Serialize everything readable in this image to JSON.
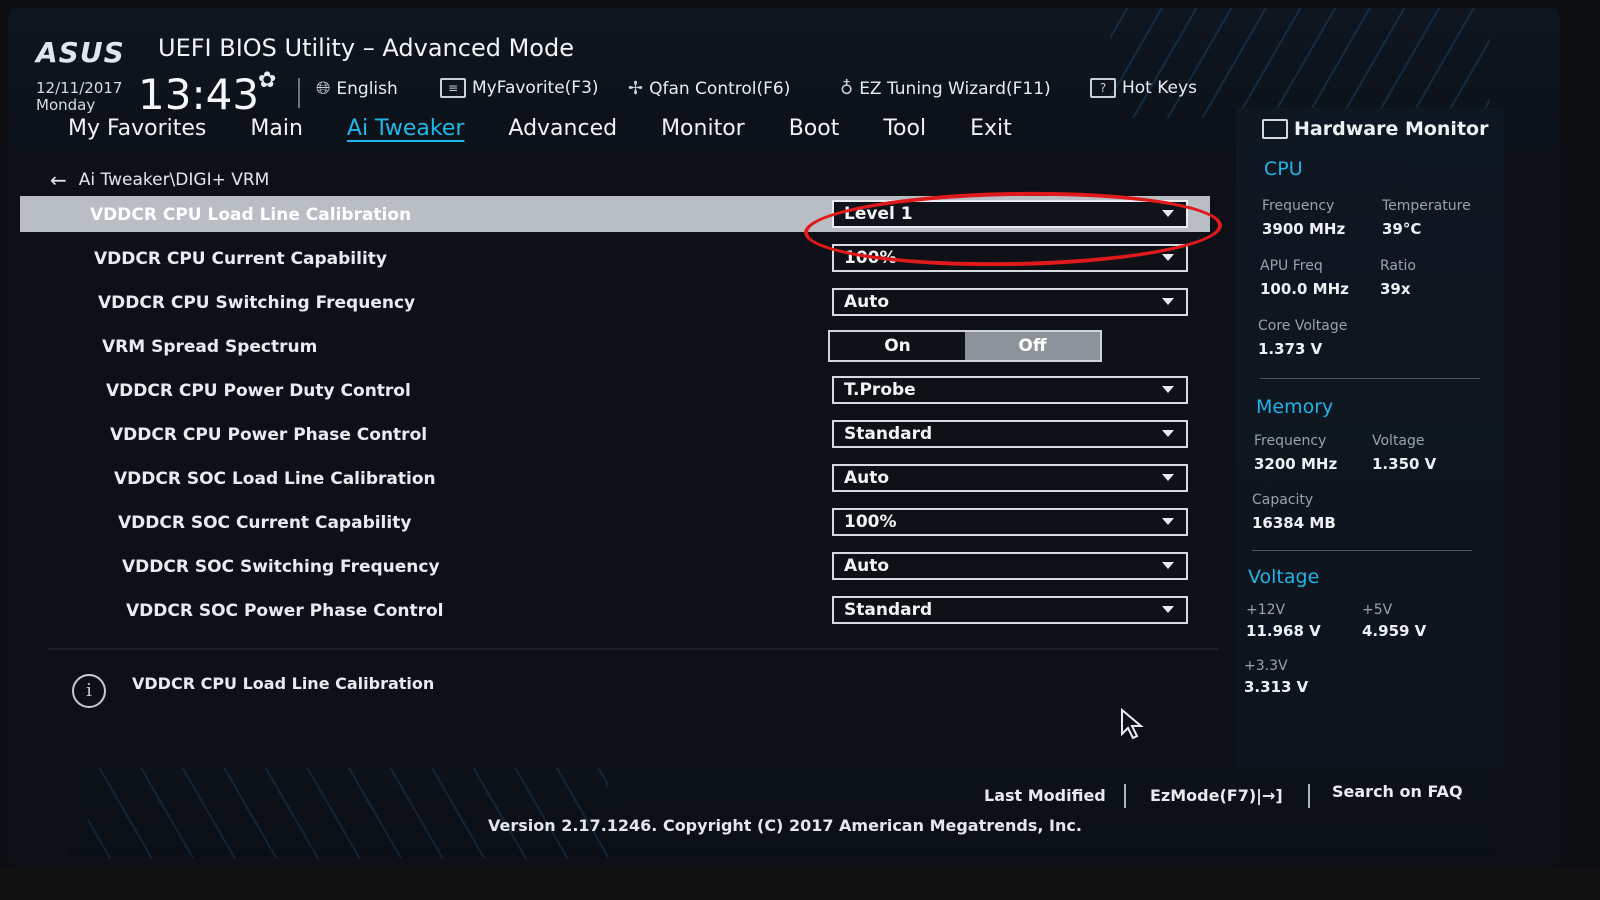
{
  "header": {
    "logo": "ASUS",
    "title": "UEFI BIOS Utility – Advanced Mode",
    "date": "12/11/2017",
    "day": "Monday",
    "time": "13:43",
    "tools": [
      {
        "label": "English",
        "icon": "globe-icon"
      },
      {
        "label": "MyFavorite(F3)",
        "icon": "favorite-icon"
      },
      {
        "label": "Qfan Control(F6)",
        "icon": "fan-icon"
      },
      {
        "label": "EZ Tuning Wizard(F11)",
        "icon": "bulb-icon"
      },
      {
        "label": "Hot Keys",
        "icon": "help-icon"
      }
    ]
  },
  "tabs": [
    "My Favorites",
    "Main",
    "Ai Tweaker",
    "Advanced",
    "Monitor",
    "Boot",
    "Tool",
    "Exit"
  ],
  "active_tab": "Ai Tweaker",
  "breadcrumb": "Ai Tweaker\\DIGI+ VRM",
  "settings": [
    {
      "label": "VDDCR CPU Load Line Calibration",
      "value": "Level 1"
    },
    {
      "label": "VDDCR CPU Current Capability",
      "value": "100%"
    },
    {
      "label": "VDDCR CPU Switching Frequency",
      "value": "Auto"
    },
    {
      "label": "VRM Spread Spectrum",
      "on": "On",
      "off": "Off",
      "selected": "Off"
    },
    {
      "label": "VDDCR CPU Power Duty Control",
      "value": "T.Probe"
    },
    {
      "label": "VDDCR CPU Power Phase Control",
      "value": "Standard"
    },
    {
      "label": "VDDCR SOC Load Line Calibration",
      "value": "Auto"
    },
    {
      "label": "VDDCR SOC Current Capability",
      "value": "100%"
    },
    {
      "label": "VDDCR SOC Switching Frequency",
      "value": "Auto"
    },
    {
      "label": "VDDCR SOC Power Phase Control",
      "value": "Standard"
    }
  ],
  "info": {
    "text": "VDDCR CPU Load Line Calibration"
  },
  "hardware_monitor": {
    "title": "Hardware Monitor",
    "cpu": {
      "heading": "CPU",
      "frequency_label": "Frequency",
      "frequency": "3900 MHz",
      "temperature_label": "Temperature",
      "temperature": "39°C",
      "apu_label": "APU Freq",
      "apu": "100.0 MHz",
      "ratio_label": "Ratio",
      "ratio": "39x",
      "core_voltage_label": "Core Voltage",
      "core_voltage": "1.373 V"
    },
    "memory": {
      "heading": "Memory",
      "frequency_label": "Frequency",
      "frequency": "3200 MHz",
      "voltage_label": "Voltage",
      "voltage": "1.350 V",
      "capacity_label": "Capacity",
      "capacity": "16384 MB"
    },
    "voltage": {
      "heading": "Voltage",
      "v12_label": "+12V",
      "v12": "11.968 V",
      "v5_label": "+5V",
      "v5": "4.959 V",
      "v33_label": "+3.3V",
      "v33": "3.313 V"
    }
  },
  "footer": {
    "last_modified": "Last Modified",
    "ezmode": "EzMode(F7)|→]",
    "search_faq": "Search on FAQ",
    "version": "Version 2.17.1246. Copyright (C) 2017 American Megatrends, Inc."
  },
  "colors": {
    "accent": "#1fb7e8",
    "annotation": "#e0191b",
    "selected_row": "#b9bec5"
  }
}
